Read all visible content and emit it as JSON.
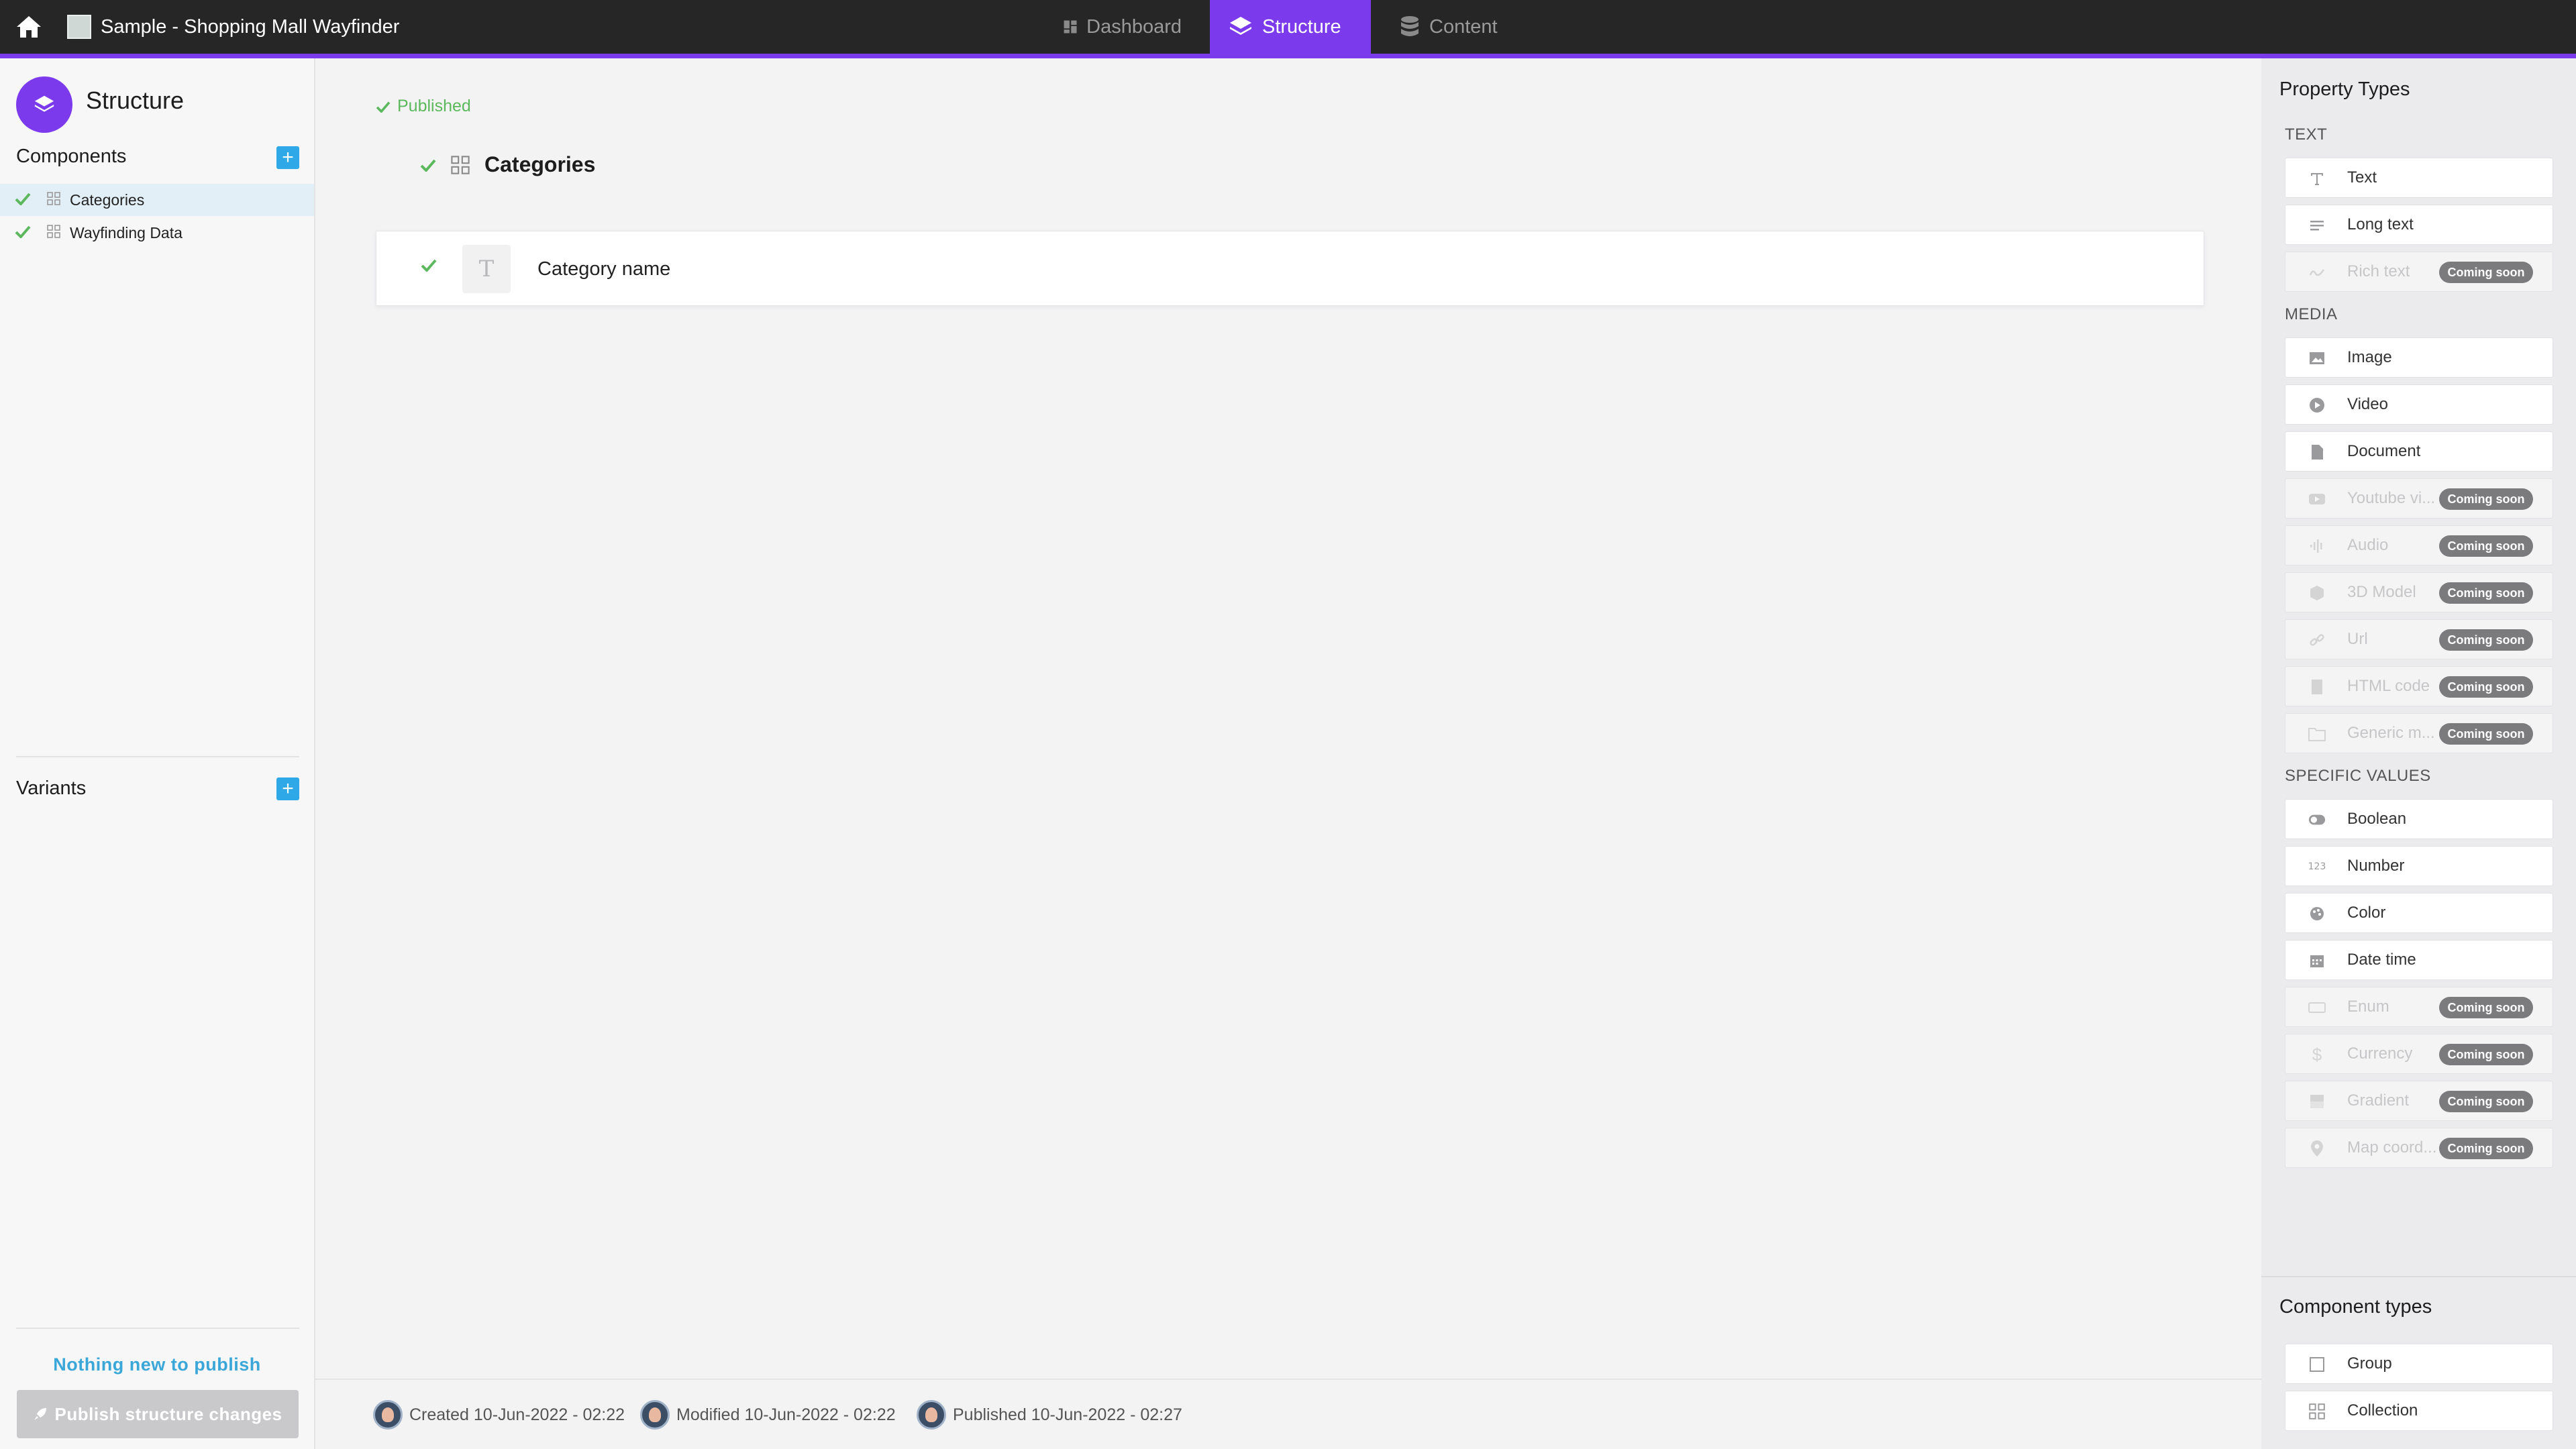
{
  "topbar": {
    "project_title": "Sample - Shopping Mall Wayfinder",
    "tabs": [
      {
        "label": "Dashboard",
        "icon": "dashboard-icon"
      },
      {
        "label": "Structure",
        "icon": "layers-icon"
      },
      {
        "label": "Content",
        "icon": "database-icon"
      }
    ],
    "active_tab": "Structure",
    "accent_color": "#7c3aed"
  },
  "sidebar": {
    "title": "Structure",
    "components_label": "Components",
    "components": [
      {
        "label": "Categories",
        "selected": true,
        "published": true
      },
      {
        "label": "Wayfinding Data",
        "selected": false,
        "published": true
      }
    ],
    "variants_label": "Variants",
    "nothing_new": "Nothing new to publish",
    "publish_label": "Publish structure changes"
  },
  "main": {
    "status": "Published",
    "component_name": "Categories",
    "properties": [
      {
        "type_glyph": "T",
        "name": "Category name"
      }
    ],
    "footer": {
      "created": "Created 10-Jun-2022 - 02:22",
      "modified": "Modified 10-Jun-2022 - 02:22",
      "published": "Published 10-Jun-2022 - 02:27"
    }
  },
  "property_types": {
    "title": "Property Types",
    "coming_soon": "Coming soon",
    "sections": [
      {
        "label": "TEXT",
        "items": [
          {
            "label": "Text",
            "icon": "text-icon",
            "soon": false
          },
          {
            "label": "Long text",
            "icon": "long-text-icon",
            "soon": false
          },
          {
            "label": "Rich text",
            "icon": "rich-text-icon",
            "soon": true
          }
        ]
      },
      {
        "label": "MEDIA",
        "items": [
          {
            "label": "Image",
            "icon": "image-icon",
            "soon": false
          },
          {
            "label": "Video",
            "icon": "video-icon",
            "soon": false
          },
          {
            "label": "Document",
            "icon": "document-icon",
            "soon": false
          },
          {
            "label": "Youtube vi...",
            "icon": "youtube-icon",
            "soon": true
          },
          {
            "label": "Audio",
            "icon": "audio-icon",
            "soon": true
          },
          {
            "label": "3D Model",
            "icon": "3d-model-icon",
            "soon": true
          },
          {
            "label": "Url",
            "icon": "link-icon",
            "soon": true
          },
          {
            "label": "HTML code",
            "icon": "html-icon",
            "soon": true
          },
          {
            "label": "Generic m...",
            "icon": "folder-icon",
            "soon": true
          }
        ]
      },
      {
        "label": "SPECIFIC VALUES",
        "items": [
          {
            "label": "Boolean",
            "icon": "toggle-icon",
            "soon": false
          },
          {
            "label": "Number",
            "icon": "number-icon",
            "soon": false
          },
          {
            "label": "Color",
            "icon": "palette-icon",
            "soon": false
          },
          {
            "label": "Date time",
            "icon": "calendar-icon",
            "soon": false
          },
          {
            "label": "Enum",
            "icon": "enum-icon",
            "soon": true
          },
          {
            "label": "Currency",
            "icon": "dollar-icon",
            "soon": true
          },
          {
            "label": "Gradient",
            "icon": "gradient-icon",
            "soon": true
          },
          {
            "label": "Map coord...",
            "icon": "map-pin-icon",
            "soon": true
          }
        ]
      }
    ]
  },
  "component_types": {
    "title": "Component types",
    "items": [
      {
        "label": "Group",
        "icon": "group-icon"
      },
      {
        "label": "Collection",
        "icon": "collection-icon"
      }
    ]
  }
}
